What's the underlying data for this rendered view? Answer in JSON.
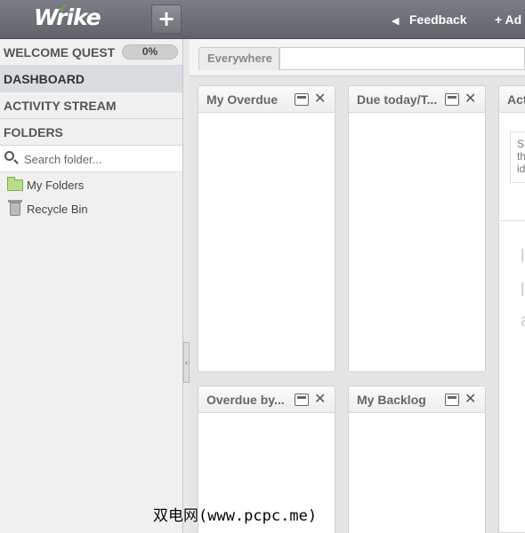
{
  "header": {
    "logo_text": "Wrike",
    "new_button_label": "+",
    "feedback_label": "Feedback",
    "add_label": "+ Ad"
  },
  "sidebar": {
    "welcome_quest": {
      "label": "WELCOME QUEST",
      "progress": "0%"
    },
    "dashboard_label": "DASHBOARD",
    "activity_label": "ACTIVITY STREAM",
    "folders_label": "FOLDERS",
    "search_placeholder": "Search folder...",
    "tree": [
      {
        "label": "My Folders",
        "icon": "folder-icon"
      },
      {
        "label": "Recycle Bin",
        "icon": "recycle-bin-icon"
      }
    ]
  },
  "main": {
    "scope_tab": "Everywhere",
    "widgets": [
      {
        "title": "My Overdue"
      },
      {
        "title": "Due today/T..."
      },
      {
        "title": "Act"
      },
      {
        "title": "Overdue by..."
      },
      {
        "title": "My Backlog"
      }
    ],
    "partial_text": [
      "S",
      "th",
      "id"
    ],
    "partial_chars": [
      "l",
      "l",
      "a"
    ]
  },
  "watermark": "双电网(www.pcpc.me)",
  "colors": {
    "topbar": "#6b6f75",
    "logo_check": "#6dbb2e",
    "sidebar_active": "#d9dde2"
  }
}
